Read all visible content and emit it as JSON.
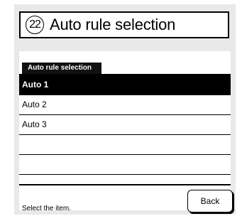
{
  "header": {
    "number": "22",
    "title": "Auto rule selection"
  },
  "section": {
    "label": "Auto rule selection"
  },
  "list": {
    "items": [
      {
        "label": "Auto 1",
        "selected": true
      },
      {
        "label": "Auto 2",
        "selected": false
      },
      {
        "label": "Auto 3",
        "selected": false
      },
      {
        "label": "",
        "selected": false
      },
      {
        "label": "",
        "selected": false
      }
    ]
  },
  "footer": {
    "status": "Select the item.",
    "back_label": "Back"
  },
  "colors": {
    "frame_background": "#e9e9e9",
    "selected_row": "#000000",
    "selected_text": "#ffffff"
  }
}
